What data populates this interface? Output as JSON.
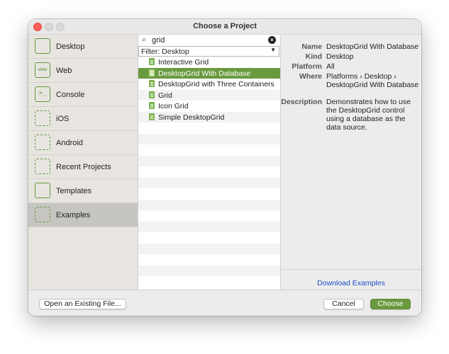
{
  "window": {
    "title": "Choose a Project"
  },
  "sidebar": {
    "items": [
      {
        "label": "Desktop",
        "icon": "desktop-icon",
        "selected": false
      },
      {
        "label": "Web",
        "icon": "web-icon",
        "selected": false
      },
      {
        "label": "Console",
        "icon": "console-icon",
        "selected": false
      },
      {
        "label": "iOS",
        "icon": "ios-icon",
        "selected": false
      },
      {
        "label": "Android",
        "icon": "android-icon",
        "selected": false
      },
      {
        "label": "Recent Projects",
        "icon": "recent-projects-icon",
        "selected": false
      },
      {
        "label": "Templates",
        "icon": "templates-icon",
        "selected": false
      },
      {
        "label": "Examples",
        "icon": "examples-icon",
        "selected": true
      }
    ],
    "icon_glyphs": {
      "web": "www",
      "console": ">_",
      "ios": ""
    }
  },
  "search": {
    "value": "grid",
    "placeholder": ""
  },
  "filter": {
    "selected": "Filter: Desktop"
  },
  "list": {
    "items": [
      {
        "label": "Interactive Grid",
        "selected": false
      },
      {
        "label": "DesktopGrid With Database",
        "selected": true
      },
      {
        "label": "DesktopGrid with Three Containers",
        "selected": false
      },
      {
        "label": "Grid",
        "selected": false
      },
      {
        "label": "Icon Grid",
        "selected": false
      },
      {
        "label": "Simple DesktopGrid",
        "selected": false
      }
    ]
  },
  "detail": {
    "name_label": "Name",
    "name": "DesktopGrid With Database",
    "kind_label": "Kind",
    "kind": "Desktop",
    "platform_label": "Platform",
    "platform": "All",
    "where_label": "Where",
    "where": "Platforms › Desktop › DesktopGrid With Database",
    "description_label": "Description",
    "description": "Demonstrates how to use the DesktopGrid control using a database as the data source.",
    "download_link": "Download Examples"
  },
  "buttons": {
    "open_existing": "Open an Existing File...",
    "cancel": "Cancel",
    "choose": "Choose"
  },
  "colors": {
    "accent_green": "#6a9a3f",
    "close_red": "#ff5f57",
    "link_blue": "#1a4fc7"
  }
}
